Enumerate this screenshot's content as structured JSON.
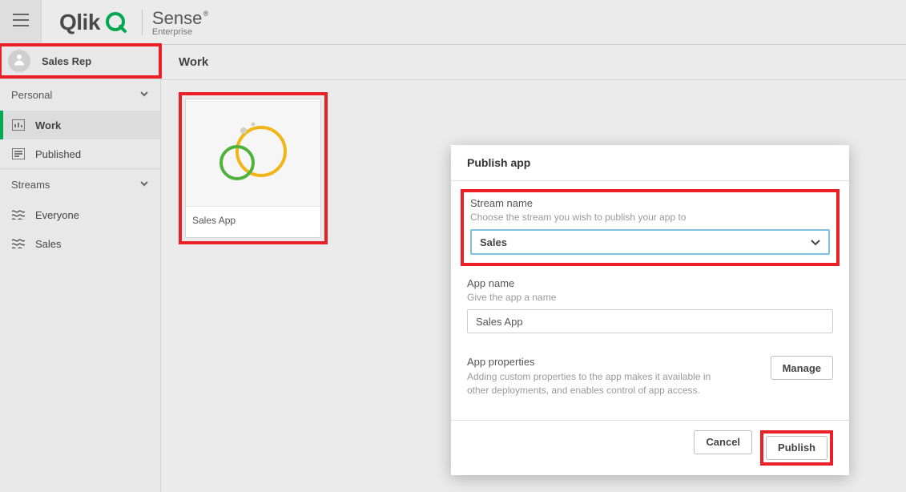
{
  "topbar": {
    "brand": "Qlik",
    "product": "Sense",
    "edition": "Enterprise"
  },
  "sidebar": {
    "user": "Sales Rep",
    "sections": {
      "personal": {
        "label": "Personal",
        "items": [
          {
            "icon": "dashboard",
            "label": "Work",
            "active": true
          },
          {
            "icon": "published",
            "label": "Published",
            "active": false
          }
        ]
      },
      "streams": {
        "label": "Streams",
        "items": [
          {
            "icon": "stream",
            "label": "Everyone"
          },
          {
            "icon": "stream",
            "label": "Sales"
          }
        ]
      }
    }
  },
  "main": {
    "header": "Work",
    "app_card_name": "Sales App"
  },
  "dialog": {
    "title": "Publish app",
    "stream": {
      "label": "Stream name",
      "help": "Choose the stream you wish to publish your app to",
      "selected": "Sales"
    },
    "appname": {
      "label": "App name",
      "help": "Give the app a name",
      "value": "Sales App"
    },
    "properties": {
      "label": "App properties",
      "help": "Adding custom properties to the app makes it available in other deployments, and enables control of app access.",
      "manage": "Manage"
    },
    "buttons": {
      "cancel": "Cancel",
      "publish": "Publish"
    }
  }
}
